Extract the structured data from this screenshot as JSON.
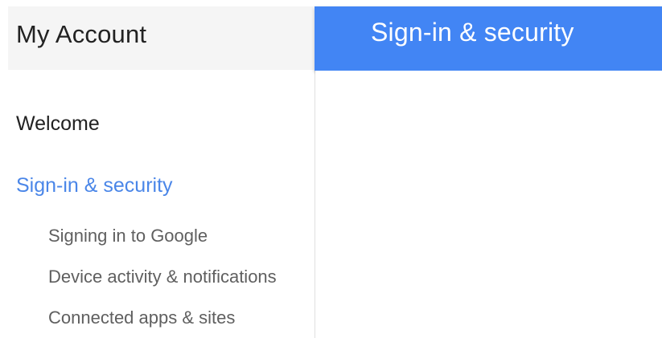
{
  "sidebar": {
    "title": "My Account",
    "items": [
      {
        "label": "Welcome"
      },
      {
        "label": "Sign-in & security",
        "active": true
      }
    ],
    "subitems": [
      {
        "label": "Signing in to Google"
      },
      {
        "label": "Device activity & notifications"
      },
      {
        "label": "Connected apps & sites"
      }
    ]
  },
  "main": {
    "header_title": "Sign-in & security"
  },
  "colors": {
    "accent": "#4285f4",
    "active_link": "#4a86e8",
    "sidebar_header_bg": "#f5f5f5"
  }
}
